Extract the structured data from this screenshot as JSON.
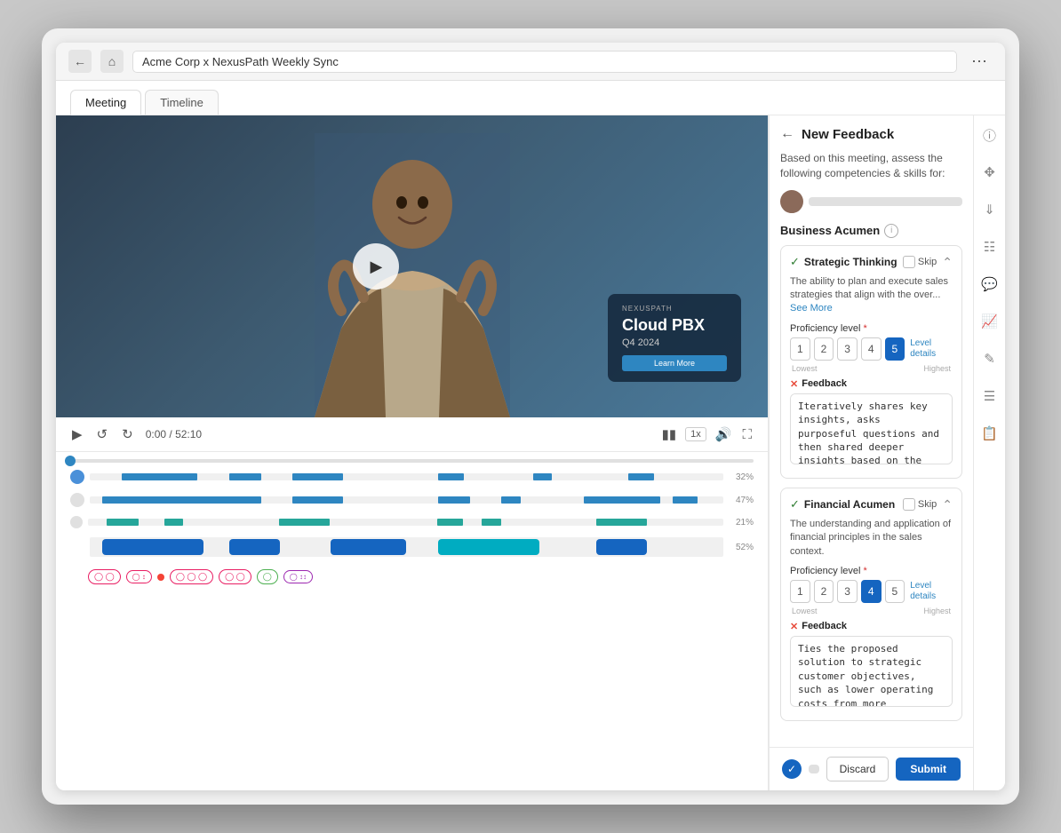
{
  "browser": {
    "title": "Acme Corp x NexusPath Weekly Sync",
    "more_label": "⋯"
  },
  "tabs": [
    {
      "label": "Meeting",
      "active": true
    },
    {
      "label": "Timeline",
      "active": false
    }
  ],
  "video": {
    "time_current": "0:00",
    "time_total": "52:10",
    "speed": "1x",
    "slide_logo": "NEXUSPATH",
    "slide_product": "Cloud PBX",
    "slide_quarter": "Q4 2024",
    "slide_btn_label": "Learn More"
  },
  "timeline": {
    "rows": [
      {
        "pct": "32%",
        "color": "#2e86c1"
      },
      {
        "pct": "47%",
        "color": "#2e86c1"
      },
      {
        "pct": "21%",
        "color": "#26a69a"
      },
      {
        "pct": "52%",
        "color": "#1565c0"
      }
    ]
  },
  "feedback_panel": {
    "title": "New Feedback",
    "subtitle": "Based on this meeting, assess the following competencies & skills for:",
    "section": "Business Acumen",
    "competencies": [
      {
        "name": "Strategic Thinking",
        "checked": true,
        "skip_label": "Skip",
        "description": "The ability to plan and execute sales strategies that align with the over...",
        "see_more": "See More",
        "prof_label": "Proficiency level",
        "levels": [
          1,
          2,
          3,
          4,
          5
        ],
        "selected_level": 5,
        "level_lowest": "Lowest",
        "level_highest": "Highest",
        "level_details": "Level details",
        "feedback_label": "Feedback",
        "feedback_text": "Iteratively shares key insights, asks purposeful questions and then shared deeper insights based on the answers to build credibility with the customer."
      },
      {
        "name": "Financial Acumen",
        "checked": true,
        "skip_label": "Skip",
        "description": "The understanding and application of financial principles in the sales context.",
        "prof_label": "Proficiency level",
        "levels": [
          1,
          2,
          3,
          4,
          5
        ],
        "selected_level": 4,
        "level_lowest": "Lowest",
        "level_highest": "Highest",
        "level_details": "Level details",
        "feedback_label": "Feedback",
        "feedback_text": "Ties the proposed solution to strategic customer objectives, such as lower operating costs from more efficient workflows."
      }
    ]
  },
  "bottom_bar": {
    "discard_label": "Discard",
    "submit_label": "Submit"
  }
}
